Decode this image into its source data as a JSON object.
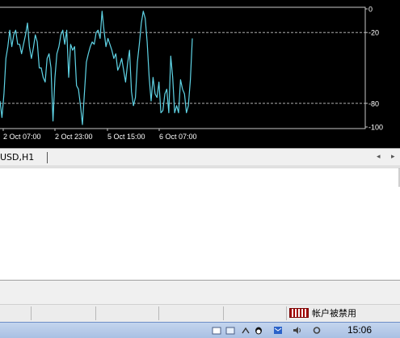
{
  "colors": {
    "chart_bg": "#000000",
    "line": "#5fd4e6",
    "grid": "#c8c8c8",
    "axis_text": "#ffffff"
  },
  "chart_data": {
    "type": "line",
    "y_axis": {
      "range": [
        -100,
        0
      ],
      "ticks": [
        "0",
        "-20",
        "-80",
        "-100"
      ],
      "levels": [
        -20,
        -80
      ]
    },
    "x_axis": {
      "tick_labels": [
        "2 Oct 07:00",
        "2 Oct 23:00",
        "5 Oct 15:00",
        "6 Oct 07:00"
      ]
    },
    "series": [
      {
        "values": [
          -78,
          -92,
          -72,
          -42,
          -32,
          -18,
          -32,
          -22,
          -18,
          -30,
          -30,
          -38,
          -30,
          -22,
          -12,
          -32,
          -42,
          -33,
          -22,
          -28,
          -50,
          -50,
          -58,
          -62,
          -42,
          -38,
          -50,
          -95,
          -58,
          -38,
          -32,
          -22,
          -18,
          -30,
          -18,
          -58,
          -30,
          -35,
          -32,
          -65,
          -68,
          -82,
          -98,
          -72,
          -45,
          -38,
          -32,
          -28,
          -30,
          -20,
          -18,
          -25,
          -2,
          -18,
          -32,
          -25,
          -30,
          -35,
          -42,
          -38,
          -52,
          -48,
          -42,
          -52,
          -62,
          -46,
          -35,
          -70,
          -82,
          -75,
          -45,
          -30,
          -12,
          -2,
          -8,
          -28,
          -58,
          -78,
          -58,
          -72,
          -75,
          -62,
          -88,
          -86,
          -72,
          -68,
          -88,
          -40,
          -58,
          -88,
          -82,
          -88,
          -60,
          -68,
          -72,
          -88,
          -82,
          -60,
          -25
        ]
      }
    ]
  },
  "tab_strip": {
    "active_tab": "USD,H1"
  },
  "status_bar": {
    "connection_text": "帐户被禁用"
  },
  "taskbar": {
    "time": "15:06"
  }
}
